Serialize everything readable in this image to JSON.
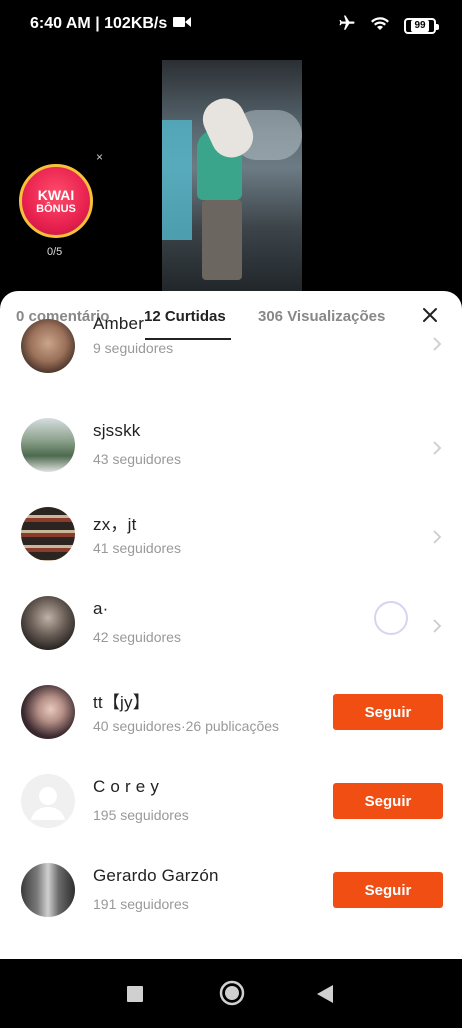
{
  "status_bar": {
    "time_speed": "6:40 AM | 102KB/s",
    "battery": "99",
    "icons": [
      "video-icon",
      "airplane-icon",
      "wifi-icon",
      "battery-icon"
    ]
  },
  "kwai": {
    "line1": "KWAI",
    "line2": "BÔNUS",
    "close": "×",
    "progress": "0/5"
  },
  "tabs": {
    "comments": "0 comentário",
    "likes": "12 Curtidas",
    "views": "306 Visualizações"
  },
  "users": [
    {
      "name": "Amber",
      "followers": "9 seguidores",
      "action": "chevron"
    },
    {
      "name": "sjsskk",
      "followers": "43 seguidores",
      "action": "chevron"
    },
    {
      "name": "zx，jt",
      "followers": "41 seguidores",
      "action": "chevron"
    },
    {
      "name": "a·",
      "followers": "42 seguidores",
      "action": "chevron"
    },
    {
      "name": "tt【jy】",
      "followers": "40 seguidores·26 publicações",
      "action": "Seguir"
    },
    {
      "name": "C o r e y",
      "followers": "195 seguidores",
      "action": "Seguir"
    },
    {
      "name": "Gerardo Garzón",
      "followers": "191 seguidores",
      "action": "Seguir"
    }
  ],
  "colors": {
    "accent": "#f04e12",
    "sheet_bg": "#ffffff",
    "text_primary": "#222222",
    "text_secondary": "#999999"
  }
}
